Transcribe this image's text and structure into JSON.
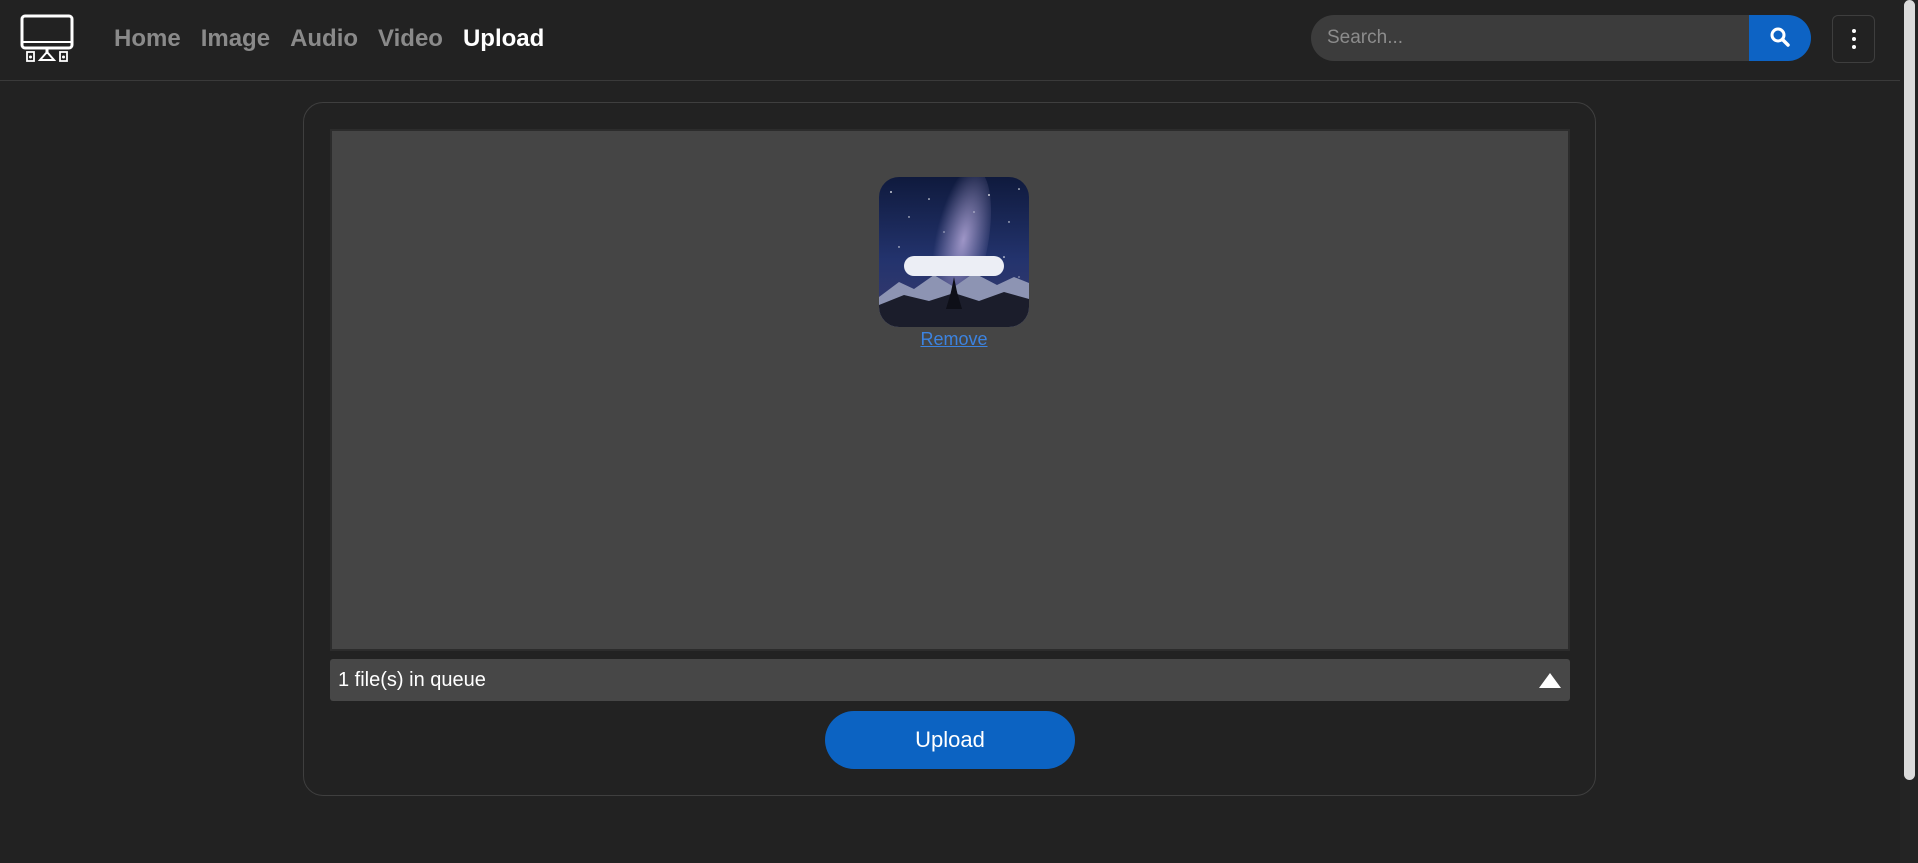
{
  "nav": {
    "items": [
      {
        "label": "Home",
        "active": false
      },
      {
        "label": "Image",
        "active": false
      },
      {
        "label": "Audio",
        "active": false
      },
      {
        "label": "Video",
        "active": false
      },
      {
        "label": "Upload",
        "active": true
      }
    ]
  },
  "search": {
    "placeholder": "Search...",
    "value": ""
  },
  "upload": {
    "remove_label": "Remove",
    "queue_text": "1 file(s) in queue",
    "upload_label": "Upload"
  },
  "colors": {
    "background": "#222222",
    "dropzone": "#454545",
    "accent": "#0c63c2",
    "link": "#3c83e0"
  },
  "icons": {
    "logo": "desktop-computer-icon",
    "search": "search-icon",
    "menu": "kebab-menu-icon",
    "queue_toggle": "triangle-up-icon"
  }
}
